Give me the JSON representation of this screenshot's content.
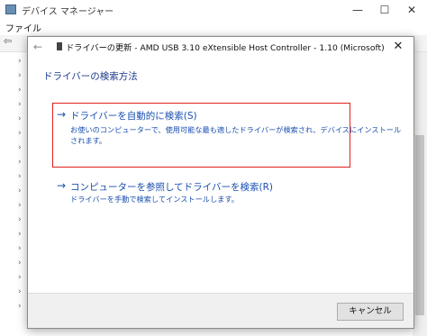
{
  "window": {
    "title": "デバイス マネージャー",
    "menu": "ファイル",
    "minimize": "—",
    "maximize": "☐",
    "close": "✕"
  },
  "dialog": {
    "close": "✕",
    "back_arrow": "←",
    "header_title": "ドライバーの更新 - AMD USB 3.10 eXtensible Host Controller - 1.10 (Microsoft)",
    "heading": "ドライバーの検索方法",
    "options": [
      {
        "arrow": "→",
        "title": "ドライバーを自動的に検索(S)",
        "description_line1": "お使いのコンピューターで、使用可能な最も適したドライバーが検索され、デバイスにインストール",
        "description_line2": "されます。"
      },
      {
        "arrow": "→",
        "title": "コンピューターを参照してドライバーを検索(R)",
        "description_line1": "ドライバーを手動で検索してインストールします。"
      }
    ],
    "cancel_label": "キャンセル"
  },
  "colors": {
    "link_blue": "#1a4fb0",
    "heading_blue": "#1a3a8c",
    "highlight_red": "#e02020"
  }
}
